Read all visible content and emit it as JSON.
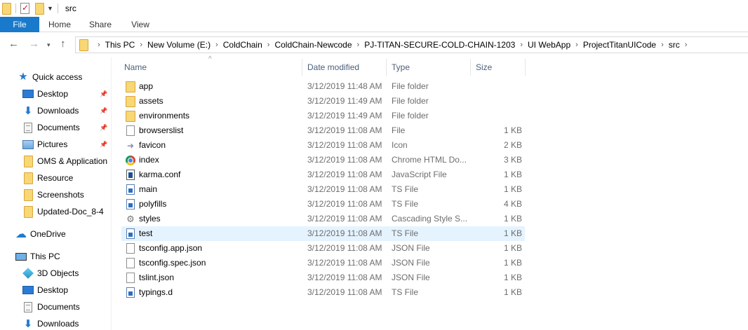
{
  "window": {
    "title": "src"
  },
  "ribbon": {
    "tabs": [
      "File",
      "Home",
      "Share",
      "View"
    ]
  },
  "address": {
    "crumbs": [
      "This PC",
      "New Volume (E:)",
      "ColdChain",
      "ColdChain-Newcode",
      "PJ-TITAN-SECURE-COLD-CHAIN-1203",
      "UI WebApp",
      "ProjectTitanUICode",
      "src"
    ]
  },
  "sidebar": {
    "items": [
      {
        "label": "Quick access",
        "icon": "star-icon",
        "pinned": false
      },
      {
        "label": "Desktop",
        "icon": "desktop-icon",
        "pinned": true
      },
      {
        "label": "Downloads",
        "icon": "downloads-icon",
        "pinned": true
      },
      {
        "label": "Documents",
        "icon": "documents-icon",
        "pinned": true
      },
      {
        "label": "Pictures",
        "icon": "pictures-icon",
        "pinned": true
      },
      {
        "label": "OMS & Application",
        "icon": "folder-icon",
        "pinned": false
      },
      {
        "label": "Resource",
        "icon": "folder-icon",
        "pinned": false
      },
      {
        "label": "Screenshots",
        "icon": "folder-icon",
        "pinned": false
      },
      {
        "label": "Updated-Doc_8-4",
        "icon": "folder-icon",
        "pinned": false
      },
      {
        "label": "OneDrive",
        "icon": "onedrive-icon",
        "pinned": false
      },
      {
        "label": "This PC",
        "icon": "this-pc-icon",
        "pinned": false
      },
      {
        "label": "3D Objects",
        "icon": "3d-objects-icon",
        "pinned": false
      },
      {
        "label": "Desktop",
        "icon": "desktop-icon",
        "pinned": false
      },
      {
        "label": "Documents",
        "icon": "documents-icon",
        "pinned": false
      },
      {
        "label": "Downloads",
        "icon": "downloads-icon",
        "pinned": false
      }
    ]
  },
  "columns": {
    "name": "Name",
    "date": "Date modified",
    "type": "Type",
    "size": "Size"
  },
  "files": [
    {
      "name": "app",
      "date": "3/12/2019 11:48 AM",
      "type": "File folder",
      "size": "",
      "icon": "folder"
    },
    {
      "name": "assets",
      "date": "3/12/2019 11:49 AM",
      "type": "File folder",
      "size": "",
      "icon": "folder"
    },
    {
      "name": "environments",
      "date": "3/12/2019 11:49 AM",
      "type": "File folder",
      "size": "",
      "icon": "folder"
    },
    {
      "name": "browserslist",
      "date": "3/12/2019 11:08 AM",
      "type": "File",
      "size": "1 KB",
      "icon": "file"
    },
    {
      "name": "favicon",
      "date": "3/12/2019 11:08 AM",
      "type": "Icon",
      "size": "2 KB",
      "icon": "arrow"
    },
    {
      "name": "index",
      "date": "3/12/2019 11:08 AM",
      "type": "Chrome HTML Do...",
      "size": "3 KB",
      "icon": "chrome"
    },
    {
      "name": "karma.conf",
      "date": "3/12/2019 11:08 AM",
      "type": "JavaScript File",
      "size": "1 KB",
      "icon": "js"
    },
    {
      "name": "main",
      "date": "3/12/2019 11:08 AM",
      "type": "TS File",
      "size": "1 KB",
      "icon": "ts"
    },
    {
      "name": "polyfills",
      "date": "3/12/2019 11:08 AM",
      "type": "TS File",
      "size": "4 KB",
      "icon": "ts"
    },
    {
      "name": "styles",
      "date": "3/12/2019 11:08 AM",
      "type": "Cascading Style S...",
      "size": "1 KB",
      "icon": "css"
    },
    {
      "name": "test",
      "date": "3/12/2019 11:08 AM",
      "type": "TS File",
      "size": "1 KB",
      "icon": "ts",
      "hover": true
    },
    {
      "name": "tsconfig.app.json",
      "date": "3/12/2019 11:08 AM",
      "type": "JSON File",
      "size": "1 KB",
      "icon": "file"
    },
    {
      "name": "tsconfig.spec.json",
      "date": "3/12/2019 11:08 AM",
      "type": "JSON File",
      "size": "1 KB",
      "icon": "file"
    },
    {
      "name": "tslint.json",
      "date": "3/12/2019 11:08 AM",
      "type": "JSON File",
      "size": "1 KB",
      "icon": "file"
    },
    {
      "name": "typings.d",
      "date": "3/12/2019 11:08 AM",
      "type": "TS File",
      "size": "1 KB",
      "icon": "ts"
    }
  ],
  "colors": {
    "accent": "#1979ca",
    "hover_row": "#e5f3ff",
    "header_text": "#4c607a"
  }
}
